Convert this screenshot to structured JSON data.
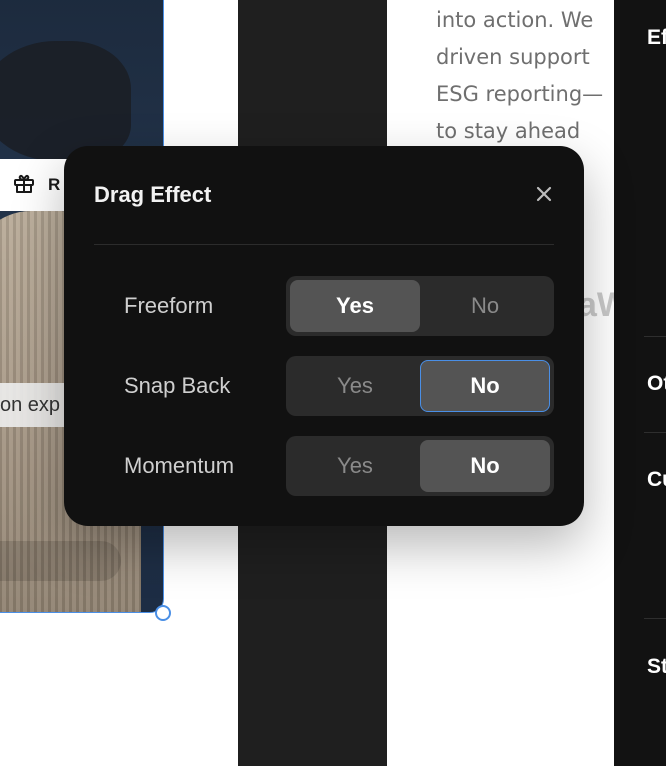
{
  "background": {
    "gift_chip_text": "R",
    "caption_chip_text": "on exp",
    "body_text_lines": [
      "into action. We",
      "driven support",
      "ESG reporting—",
      "to stay ahead"
    ],
    "faded_word": "aW",
    "side_panel_labels": [
      "Ef",
      "Ot",
      "Cu",
      "St"
    ]
  },
  "popover": {
    "title": "Drag Effect",
    "close_icon": "close-icon",
    "rows": [
      {
        "label": "Freeform",
        "yes": "Yes",
        "no": "No",
        "selected": "Yes"
      },
      {
        "label": "Snap Back",
        "yes": "Yes",
        "no": "No",
        "selected": "No"
      },
      {
        "label": "Momentum",
        "yes": "Yes",
        "no": "No",
        "selected": "No"
      }
    ]
  },
  "colors": {
    "accent": "#4a8fe6",
    "popover_bg": "#111111",
    "segment_bg": "#2b2b2b",
    "segment_active": "#545454"
  }
}
